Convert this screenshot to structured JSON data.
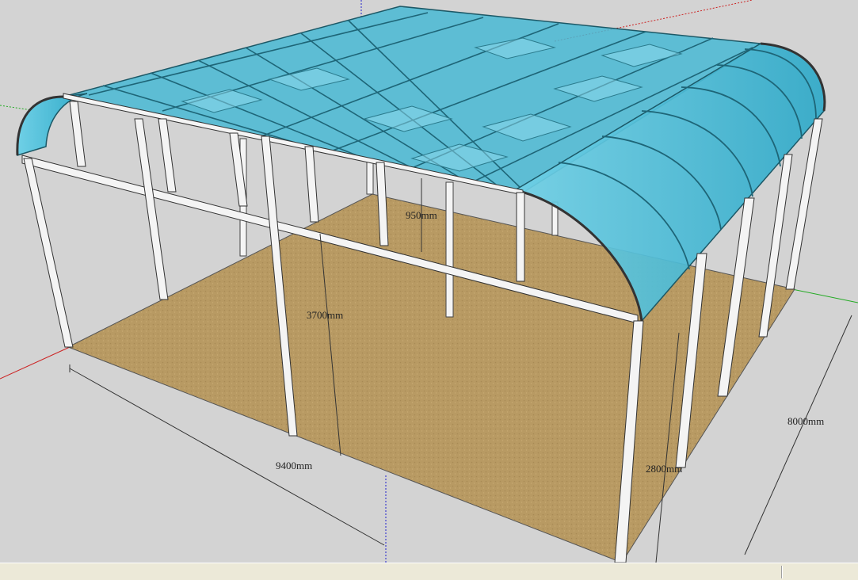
{
  "dimensions": {
    "length": "9400mm",
    "width": "8000mm",
    "total_height": "3700mm",
    "post_height": "2800mm",
    "arch_height": "950mm"
  },
  "colors": {
    "background": "#d3d3d3",
    "floor": "#b89a63",
    "glass": "#3fb6d2",
    "frame": "#f4f4f4",
    "axis_red": "#cc2222",
    "axis_green": "#22aa22",
    "axis_blue": "#2222cc",
    "status_bar": "#ece9d8"
  },
  "status_bar": {
    "text": ""
  }
}
